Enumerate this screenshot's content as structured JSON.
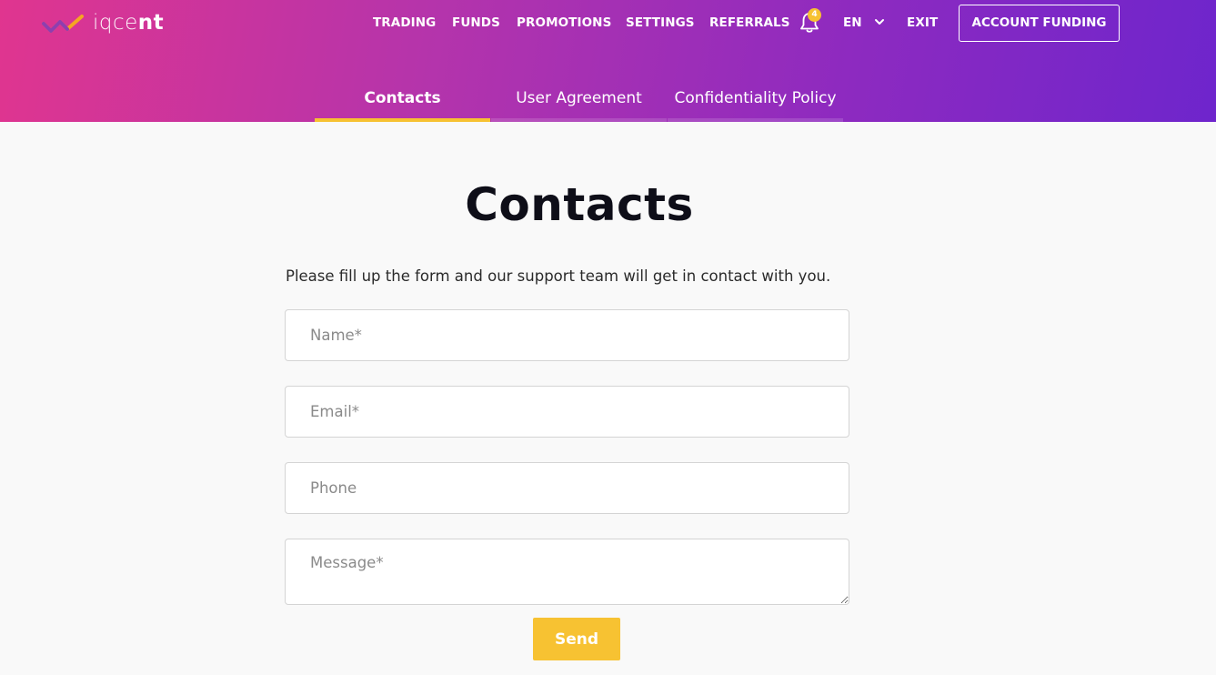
{
  "brand": {
    "logo_thin": "iqce",
    "logo_bold": "nt"
  },
  "nav": {
    "trading": "TRADING",
    "funds": "FUNDS",
    "promotions": "PROMOTIONS",
    "settings": "SETTINGS",
    "referrals": "REFERRALS",
    "notifications_count": "4",
    "language": "EN",
    "exit": "EXIT",
    "account_funding": "ACCOUNT FUNDING"
  },
  "tabs": [
    {
      "label": "Contacts",
      "active": true
    },
    {
      "label": "User Agreement",
      "active": false
    },
    {
      "label": "Confidentiality Policy",
      "active": false
    }
  ],
  "main": {
    "title": "Contacts",
    "intro": "Please fill up the form and our support team will get in contact with you."
  },
  "form": {
    "name_placeholder": "Name*",
    "email_placeholder": "Email*",
    "phone_placeholder": "Phone",
    "message_placeholder": "Message*",
    "send_label": "Send"
  },
  "colors": {
    "accent": "#f7c232",
    "header_gradient_start": "#e0358f",
    "header_gradient_end": "#6e25cc",
    "background": "#f9f9f9"
  },
  "icons": {
    "logo": "iqcent-logo-icon",
    "notifications": "bell-icon",
    "language_dropdown": "chevron-down-icon"
  }
}
